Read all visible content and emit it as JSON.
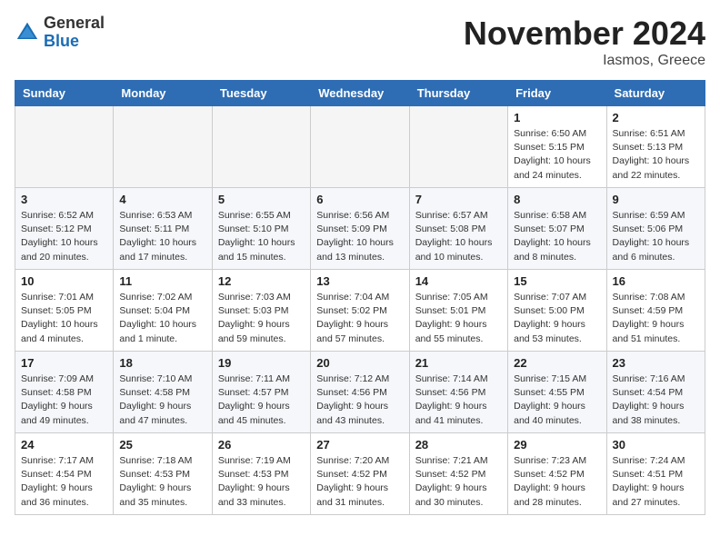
{
  "header": {
    "logo_general": "General",
    "logo_blue": "Blue",
    "month_title": "November 2024",
    "location": "Iasmos, Greece"
  },
  "weekdays": [
    "Sunday",
    "Monday",
    "Tuesday",
    "Wednesday",
    "Thursday",
    "Friday",
    "Saturday"
  ],
  "weeks": [
    [
      {
        "day": "",
        "info": ""
      },
      {
        "day": "",
        "info": ""
      },
      {
        "day": "",
        "info": ""
      },
      {
        "day": "",
        "info": ""
      },
      {
        "day": "",
        "info": ""
      },
      {
        "day": "1",
        "info": "Sunrise: 6:50 AM\nSunset: 5:15 PM\nDaylight: 10 hours\nand 24 minutes."
      },
      {
        "day": "2",
        "info": "Sunrise: 6:51 AM\nSunset: 5:13 PM\nDaylight: 10 hours\nand 22 minutes."
      }
    ],
    [
      {
        "day": "3",
        "info": "Sunrise: 6:52 AM\nSunset: 5:12 PM\nDaylight: 10 hours\nand 20 minutes."
      },
      {
        "day": "4",
        "info": "Sunrise: 6:53 AM\nSunset: 5:11 PM\nDaylight: 10 hours\nand 17 minutes."
      },
      {
        "day": "5",
        "info": "Sunrise: 6:55 AM\nSunset: 5:10 PM\nDaylight: 10 hours\nand 15 minutes."
      },
      {
        "day": "6",
        "info": "Sunrise: 6:56 AM\nSunset: 5:09 PM\nDaylight: 10 hours\nand 13 minutes."
      },
      {
        "day": "7",
        "info": "Sunrise: 6:57 AM\nSunset: 5:08 PM\nDaylight: 10 hours\nand 10 minutes."
      },
      {
        "day": "8",
        "info": "Sunrise: 6:58 AM\nSunset: 5:07 PM\nDaylight: 10 hours\nand 8 minutes."
      },
      {
        "day": "9",
        "info": "Sunrise: 6:59 AM\nSunset: 5:06 PM\nDaylight: 10 hours\nand 6 minutes."
      }
    ],
    [
      {
        "day": "10",
        "info": "Sunrise: 7:01 AM\nSunset: 5:05 PM\nDaylight: 10 hours\nand 4 minutes."
      },
      {
        "day": "11",
        "info": "Sunrise: 7:02 AM\nSunset: 5:04 PM\nDaylight: 10 hours\nand 1 minute."
      },
      {
        "day": "12",
        "info": "Sunrise: 7:03 AM\nSunset: 5:03 PM\nDaylight: 9 hours\nand 59 minutes."
      },
      {
        "day": "13",
        "info": "Sunrise: 7:04 AM\nSunset: 5:02 PM\nDaylight: 9 hours\nand 57 minutes."
      },
      {
        "day": "14",
        "info": "Sunrise: 7:05 AM\nSunset: 5:01 PM\nDaylight: 9 hours\nand 55 minutes."
      },
      {
        "day": "15",
        "info": "Sunrise: 7:07 AM\nSunset: 5:00 PM\nDaylight: 9 hours\nand 53 minutes."
      },
      {
        "day": "16",
        "info": "Sunrise: 7:08 AM\nSunset: 4:59 PM\nDaylight: 9 hours\nand 51 minutes."
      }
    ],
    [
      {
        "day": "17",
        "info": "Sunrise: 7:09 AM\nSunset: 4:58 PM\nDaylight: 9 hours\nand 49 minutes."
      },
      {
        "day": "18",
        "info": "Sunrise: 7:10 AM\nSunset: 4:58 PM\nDaylight: 9 hours\nand 47 minutes."
      },
      {
        "day": "19",
        "info": "Sunrise: 7:11 AM\nSunset: 4:57 PM\nDaylight: 9 hours\nand 45 minutes."
      },
      {
        "day": "20",
        "info": "Sunrise: 7:12 AM\nSunset: 4:56 PM\nDaylight: 9 hours\nand 43 minutes."
      },
      {
        "day": "21",
        "info": "Sunrise: 7:14 AM\nSunset: 4:56 PM\nDaylight: 9 hours\nand 41 minutes."
      },
      {
        "day": "22",
        "info": "Sunrise: 7:15 AM\nSunset: 4:55 PM\nDaylight: 9 hours\nand 40 minutes."
      },
      {
        "day": "23",
        "info": "Sunrise: 7:16 AM\nSunset: 4:54 PM\nDaylight: 9 hours\nand 38 minutes."
      }
    ],
    [
      {
        "day": "24",
        "info": "Sunrise: 7:17 AM\nSunset: 4:54 PM\nDaylight: 9 hours\nand 36 minutes."
      },
      {
        "day": "25",
        "info": "Sunrise: 7:18 AM\nSunset: 4:53 PM\nDaylight: 9 hours\nand 35 minutes."
      },
      {
        "day": "26",
        "info": "Sunrise: 7:19 AM\nSunset: 4:53 PM\nDaylight: 9 hours\nand 33 minutes."
      },
      {
        "day": "27",
        "info": "Sunrise: 7:20 AM\nSunset: 4:52 PM\nDaylight: 9 hours\nand 31 minutes."
      },
      {
        "day": "28",
        "info": "Sunrise: 7:21 AM\nSunset: 4:52 PM\nDaylight: 9 hours\nand 30 minutes."
      },
      {
        "day": "29",
        "info": "Sunrise: 7:23 AM\nSunset: 4:52 PM\nDaylight: 9 hours\nand 28 minutes."
      },
      {
        "day": "30",
        "info": "Sunrise: 7:24 AM\nSunset: 4:51 PM\nDaylight: 9 hours\nand 27 minutes."
      }
    ]
  ]
}
